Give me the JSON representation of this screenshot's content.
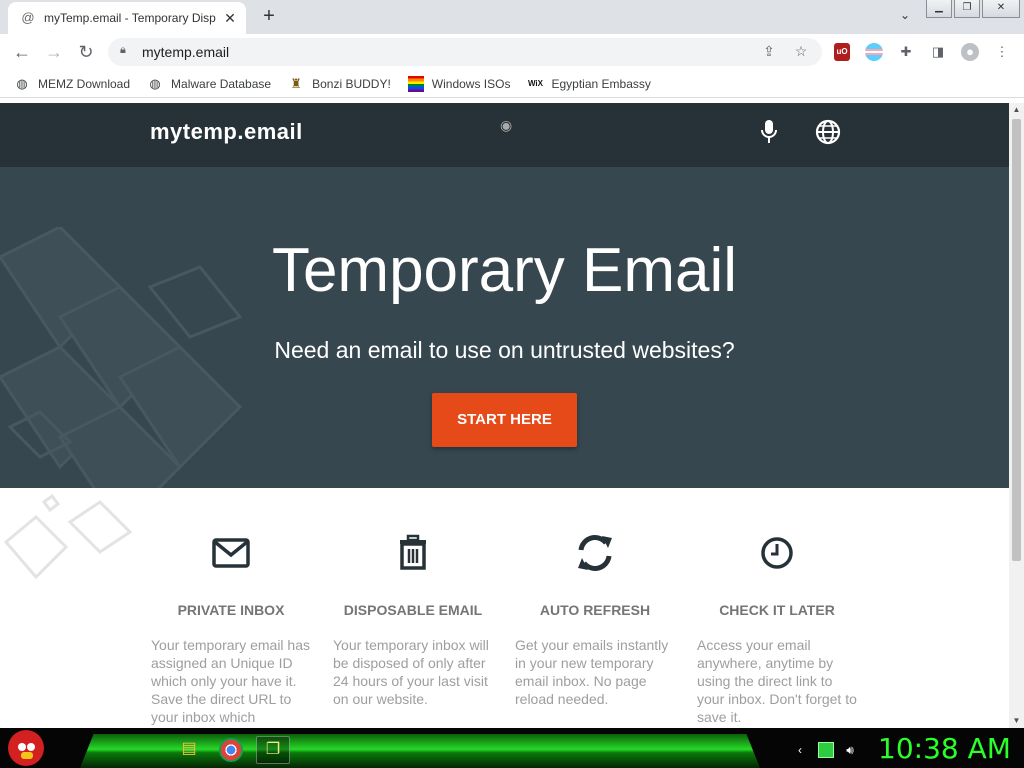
{
  "browser": {
    "tab": {
      "title": "myTemp.email - Temporary Disp",
      "favicon": "at-sign-icon"
    },
    "url": "mytemp.email",
    "bookmarks": [
      {
        "label": "MEMZ Download",
        "icon": "globe-icon"
      },
      {
        "label": "Malware Database",
        "icon": "globe-icon"
      },
      {
        "label": "Bonzi BUDDY!",
        "icon": "bonzi-icon"
      },
      {
        "label": "Windows ISOs",
        "icon": "rainbow-flag-icon"
      },
      {
        "label": "Egyptian Embassy",
        "icon": "wix-icon",
        "icon_text": "WiX"
      }
    ],
    "extensions": [
      "ublock-icon",
      "trans-flag-icon",
      "puzzle-icon",
      "sidepanel-icon",
      "profile-icon"
    ],
    "ublock_label": "uO"
  },
  "site": {
    "logo": "mytemp.email",
    "hero_title": "Temporary Email",
    "hero_subtitle": "Need an email to use on untrusted websites?",
    "cta_label": "START HERE",
    "colors": {
      "header": "#263238",
      "hero": "#37474f",
      "cta": "#e64a19"
    },
    "features": [
      {
        "icon": "envelope-icon",
        "title": "PRIVATE INBOX",
        "text": "Your temporary email has assigned an Unique ID which only your have it. Save the direct URL to your inbox which"
      },
      {
        "icon": "trash-icon",
        "title": "DISPOSABLE EMAIL",
        "text": "Your temporary inbox will be disposed of only after 24 hours of your last visit on our website."
      },
      {
        "icon": "refresh-icon",
        "title": "AUTO REFRESH",
        "text": "Get your emails instantly in your new temporary email inbox. No page reload needed."
      },
      {
        "icon": "clock-icon",
        "title": "CHECK IT LATER",
        "text": "Access your email anywhere, anytime by using the direct link to your inbox. Don't forget to save it."
      }
    ]
  },
  "taskbar": {
    "clock": "10:38 AM"
  }
}
